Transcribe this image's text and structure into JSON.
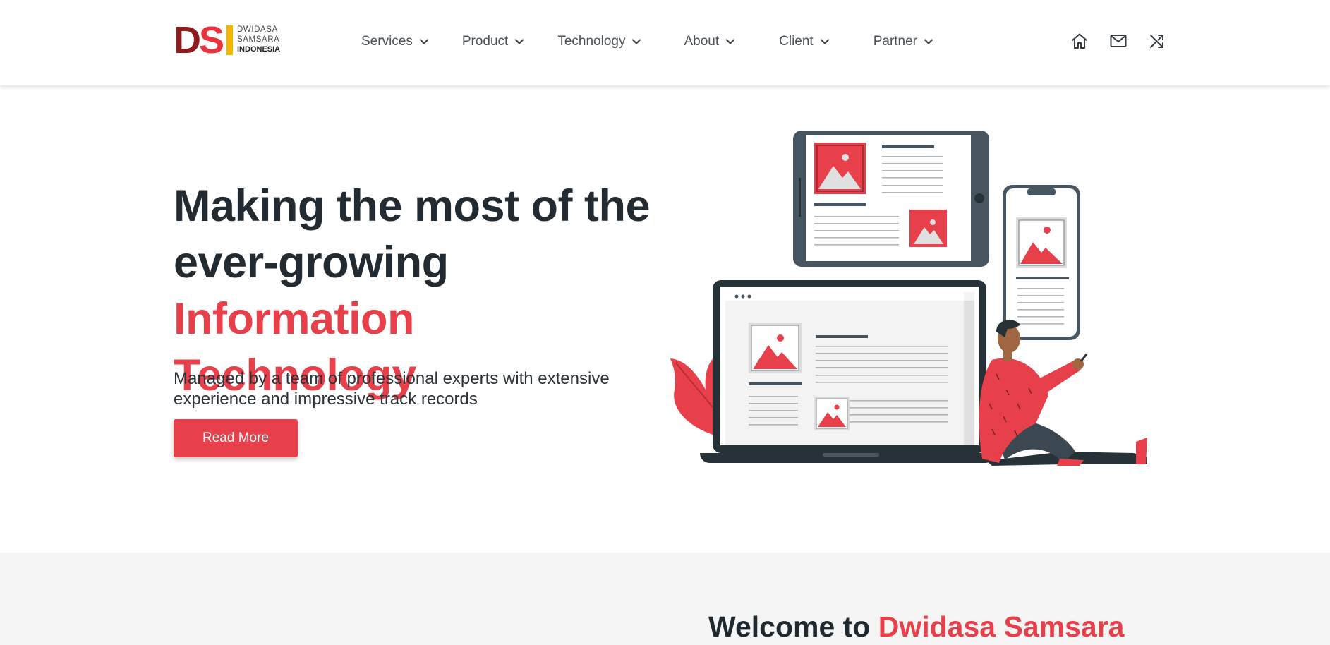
{
  "brand": {
    "mark_d": "D",
    "mark_s": "S",
    "line1": "DWIDASA",
    "line2": "SAMSARA",
    "line3": "INDONESIA",
    "colors": {
      "dark_red": "#8e1c1f",
      "red": "#e8333f",
      "yellow": "#f4b400"
    }
  },
  "nav": {
    "items": [
      {
        "label": "Services",
        "icon": "chevron-down-icon"
      },
      {
        "label": "Product",
        "icon": "chevron-down-icon"
      },
      {
        "label": "Technology",
        "icon": "chevron-down-icon"
      },
      {
        "label": "About",
        "icon": "chevron-down-icon"
      },
      {
        "label": "Client",
        "icon": "chevron-down-icon"
      },
      {
        "label": "Partner",
        "icon": "chevron-down-icon"
      }
    ],
    "actions": [
      "home-icon",
      "mail-icon",
      "shuffle-icon"
    ]
  },
  "hero": {
    "title_line1": "Making the most of the",
    "title_line2": "ever-growing",
    "title_accent": "Information Technology",
    "subtitle": "Managed by a team of professional experts with extensive experience and impressive track records",
    "cta_label": "Read More"
  },
  "welcome": {
    "prefix": "Welcome to ",
    "accent": "Dwidasa Samsara"
  },
  "colors": {
    "accent": "#e8404a",
    "heading": "#212b31",
    "device_frame": "#475560",
    "band": "#f5f5f5"
  }
}
